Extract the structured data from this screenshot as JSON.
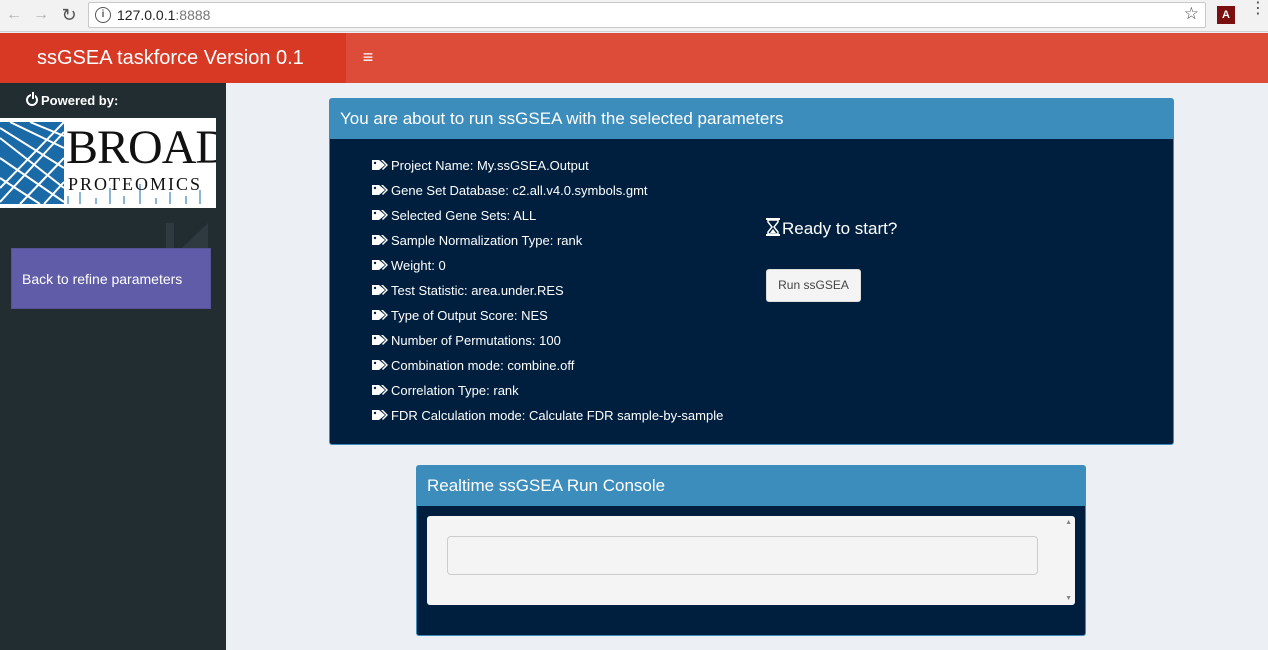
{
  "browser": {
    "url_host": "127.0.0.1",
    "url_port": ":8888",
    "back_glyph": "←",
    "forward_glyph": "→",
    "reload_glyph": "↻",
    "star_glyph": "☆",
    "info_glyph": "i",
    "pdf_glyph": "A",
    "menu_glyph": "⋮"
  },
  "header": {
    "title": "ssGSEA taskforce Version 0.1",
    "menu_glyph": "≡"
  },
  "sidebar": {
    "powered_by": "Powered by:",
    "logo_broad": "BROAD",
    "logo_proteomics": "PROTEOMICS",
    "back_button": "Back to refine parameters"
  },
  "summary": {
    "title": "You are about to run ssGSEA with the selected parameters",
    "params": [
      "Project Name: My.ssGSEA.Output",
      "Gene Set Database: c2.all.v4.0.symbols.gmt",
      "Selected Gene Sets: ALL",
      "Sample Normalization Type: rank",
      "Weight: 0",
      "Test Statistic: area.under.RES",
      "Type of Output Score: NES",
      "Number of Permutations: 100",
      "Combination mode: combine.off",
      "Correlation Type: rank",
      "FDR Calculation mode: Calculate FDR sample-by-sample"
    ],
    "ready_text": "Ready to start?",
    "run_button": "Run ssGSEA"
  },
  "console": {
    "title": "Realtime ssGSEA Run Console",
    "input_value": "",
    "scroll_up_glyph": "▲",
    "scroll_down_glyph": "▼"
  },
  "colors": {
    "header": "#dd4b39",
    "logo_bg": "#d73925",
    "sidebar": "#222d32",
    "box_header": "#3c8dbc",
    "box_body": "#001f3f",
    "back_button": "#605ca8"
  }
}
